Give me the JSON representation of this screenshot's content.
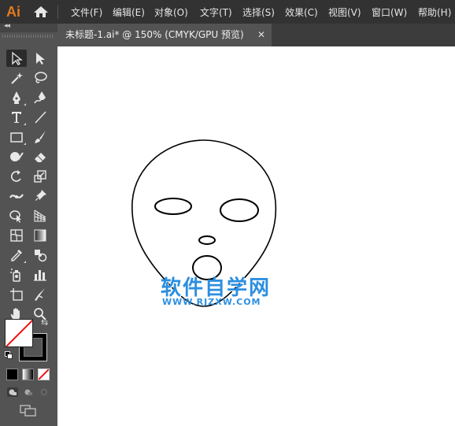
{
  "app": {
    "logo_text": "Ai"
  },
  "menu": {
    "items": [
      "文件(F)",
      "编辑(E)",
      "对象(O)",
      "文字(T)",
      "选择(S)",
      "效果(C)",
      "视图(V)",
      "窗口(W)",
      "帮助(H)"
    ]
  },
  "tabs": {
    "document_title": "未标题-1.ai* @ 150% (CMYK/GPU 预览)",
    "close_glyph": "✕"
  },
  "toolpanel": {
    "collapse_glyph": "◂◂",
    "tools": [
      {
        "name": "selection-tool-icon",
        "active": true
      },
      {
        "name": "direct-selection-tool-icon"
      },
      {
        "name": "magic-wand-tool-icon"
      },
      {
        "name": "lasso-tool-icon"
      },
      {
        "name": "pen-tool-icon"
      },
      {
        "name": "curvature-tool-icon"
      },
      {
        "name": "type-tool-icon"
      },
      {
        "name": "line-segment-tool-icon"
      },
      {
        "name": "rectangle-tool-icon"
      },
      {
        "name": "paintbrush-tool-icon"
      },
      {
        "name": "shaper-tool-icon"
      },
      {
        "name": "eraser-tool-icon"
      },
      {
        "name": "rotate-tool-icon"
      },
      {
        "name": "scale-tool-icon"
      },
      {
        "name": "width-tool-icon"
      },
      {
        "name": "puppet-warp-tool-icon"
      },
      {
        "name": "shape-builder-tool-icon"
      },
      {
        "name": "perspective-grid-tool-icon"
      },
      {
        "name": "mesh-tool-icon"
      },
      {
        "name": "gradient-tool-icon"
      },
      {
        "name": "eyedropper-tool-icon"
      },
      {
        "name": "blend-tool-icon"
      },
      {
        "name": "symbol-sprayer-tool-icon"
      },
      {
        "name": "column-graph-tool-icon"
      },
      {
        "name": "artboard-tool-icon"
      },
      {
        "name": "slice-tool-icon"
      },
      {
        "name": "hand-tool-icon"
      },
      {
        "name": "zoom-tool-icon"
      }
    ],
    "colors": {
      "fill": "#ffffff",
      "stroke": "#000000",
      "none_line": "#e11111"
    }
  },
  "canvas": {
    "background": "#ffffff",
    "watermark": {
      "title": "软件自学网",
      "url": "WWW.RJZXW.COM",
      "color": "#2c8fe0"
    }
  }
}
